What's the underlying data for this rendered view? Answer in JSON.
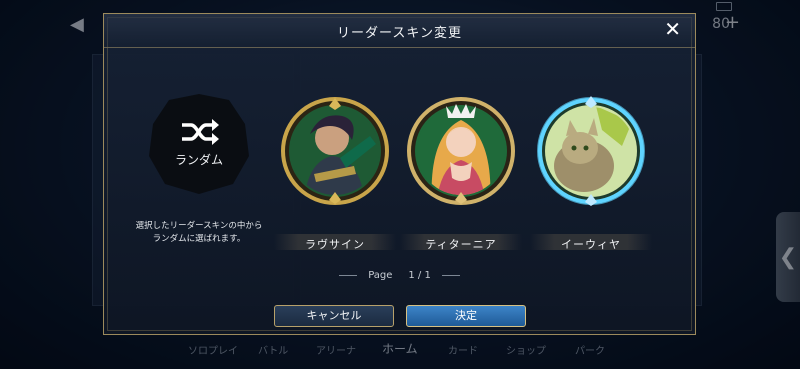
{
  "background": {
    "currency_value": "80",
    "nav_items": [
      "ソロプレイ",
      "バトル",
      "アリーナ",
      "ホーム",
      "カード",
      "ショップ",
      "パーク"
    ]
  },
  "modal": {
    "title": "リーダースキン変更",
    "close_icon": "close-icon",
    "random_option": {
      "label": "ランダム",
      "icon": "shuffle-icon",
      "description_line1": "選択したリーダースキンの中から",
      "description_line2": "ランダムに選ばれます。"
    },
    "skins": [
      {
        "name": "ラヴサイン",
        "selected": false,
        "frame_color": "#c9a54a",
        "bg_color": "#1e5a34"
      },
      {
        "name": "ティターニア",
        "selected": false,
        "frame_color": "#d0b26a",
        "bg_color": "#1f6a3a"
      },
      {
        "name": "イーウィヤ",
        "selected": true,
        "frame_color": "#5fd4ff",
        "bg_color": "#cfe3a6"
      }
    ],
    "pager": {
      "label": "Page",
      "current": "1",
      "separator": "/",
      "total": "1"
    },
    "buttons": {
      "cancel": "キャンセル",
      "confirm": "決定"
    }
  },
  "colors": {
    "accent_gold": "#b7a16a",
    "confirm_blue": "#2f74b8",
    "selected_glow": "#5fd4ff"
  }
}
